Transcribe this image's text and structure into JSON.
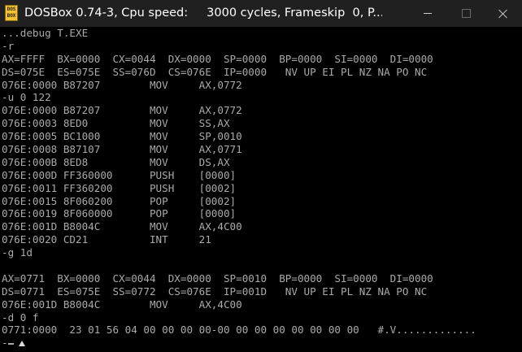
{
  "window": {
    "title": "DOSBox 0.74-3, Cpu speed:     3000 cycles, Frameskip  0, P...",
    "icon_text": [
      "DOS",
      "BOX"
    ]
  },
  "icons": {
    "app": "dosbox-icon",
    "minimize": "minimize-icon",
    "maximize": "maximize-icon",
    "close": "close-icon",
    "pointer": "mouse-pointer-icon"
  },
  "colors": {
    "titlebar_bg": "#202020",
    "screen_bg": "#000000",
    "text": "#aaaaaa"
  },
  "console": {
    "lines": [
      "...debug T.EXE",
      "-r",
      "AX=FFFF  BX=0000  CX=0044  DX=0000  SP=0000  BP=0000  SI=0000  DI=0000",
      "DS=075E  ES=075E  SS=076D  CS=076E  IP=0000   NV UP EI PL NZ NA PO NC",
      "076E:0000 B87207        MOV     AX,0772",
      "-u 0 122",
      "076E:0000 B87207        MOV     AX,0772",
      "076E:0003 8ED0          MOV     SS,AX",
      "076E:0005 BC1000        MOV     SP,0010",
      "076E:0008 B87107        MOV     AX,0771",
      "076E:000B 8ED8          MOV     DS,AX",
      "076E:000D FF360000      PUSH    [0000]",
      "076E:0011 FF360200      PUSH    [0002]",
      "076E:0015 8F060200      POP     [0002]",
      "076E:0019 8F060000      POP     [0000]",
      "076E:001D B8004C        MOV     AX,4C00",
      "076E:0020 CD21          INT     21",
      "-g 1d",
      "",
      "AX=0771  BX=0000  CX=0044  DX=0000  SP=0010  BP=0000  SI=0000  DI=0000",
      "DS=0771  ES=075E  SS=0772  CS=076E  IP=001D   NV UP EI PL NZ NA PO NC",
      "076E:001D B8004C        MOV     AX,4C00",
      "-d 0 f",
      "0771:0000  23 01 56 04 00 00 00 00-00 00 00 00 00 00 00 00   #.V............."
    ],
    "prompt": "-"
  }
}
